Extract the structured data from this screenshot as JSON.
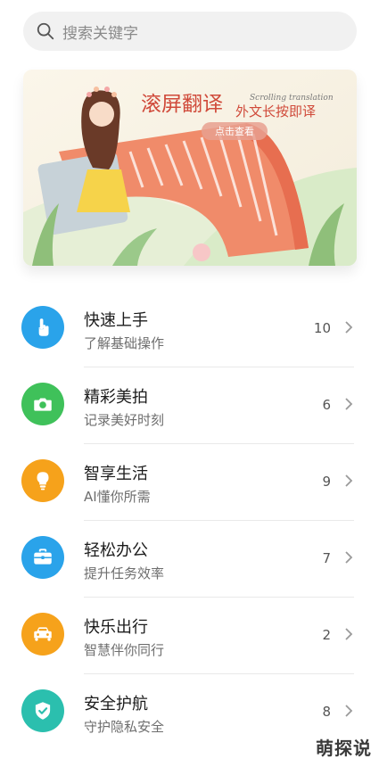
{
  "search": {
    "placeholder": "搜索关键字",
    "icon": "search-icon"
  },
  "banner": {
    "title_cn": "滚屏翻译",
    "title_en": "Scrolling translation",
    "subtitle": "外文长按即译",
    "button": "点击查看"
  },
  "items": [
    {
      "title": "快速上手",
      "sub": "了解基础操作",
      "count": "10",
      "color": "#2aa3ea",
      "icon": "tap-hand-icon"
    },
    {
      "title": "精彩美拍",
      "sub": "记录美好时刻",
      "count": "6",
      "color": "#3fc15a",
      "icon": "camera-icon"
    },
    {
      "title": "智享生活",
      "sub": "AI懂你所需",
      "count": "9",
      "color": "#f6a21b",
      "icon": "lightbulb-icon"
    },
    {
      "title": "轻松办公",
      "sub": "提升任务效率",
      "count": "7",
      "color": "#2aa3ea",
      "icon": "briefcase-icon"
    },
    {
      "title": "快乐出行",
      "sub": "智慧伴你同行",
      "count": "2",
      "color": "#f6a21b",
      "icon": "car-icon"
    },
    {
      "title": "安全护航",
      "sub": "守护隐私安全",
      "count": "8",
      "color": "#2bbfae",
      "icon": "shield-check-icon"
    }
  ],
  "watermark": "萌探说"
}
